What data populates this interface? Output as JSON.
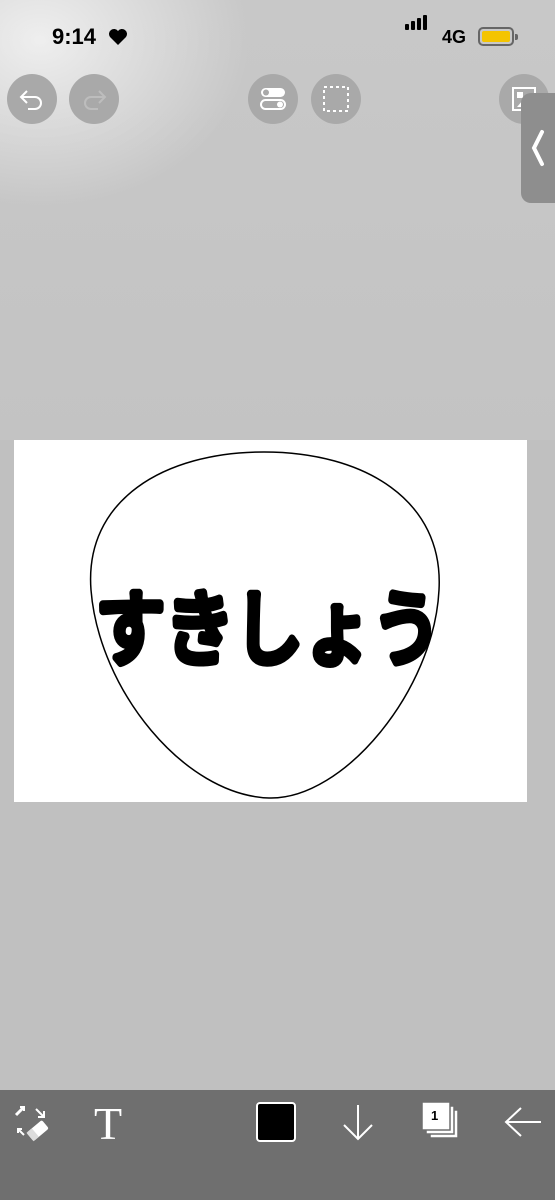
{
  "status_bar": {
    "time": "9:14",
    "network": "4G",
    "battery_color": "#f4c400"
  },
  "toolbar": {
    "undo_icon": "undo-icon",
    "redo_icon": "redo-icon",
    "toggle_icon": "toggle-switches-icon",
    "selection_icon": "dashed-selection-icon",
    "gallery_icon": "image-gallery-icon",
    "side_panel_icon": "chevron-left-icon"
  },
  "canvas": {
    "text": "すきしょう",
    "text_color": "#000000",
    "background": "#ffffff"
  },
  "bottom_bar": {
    "transform_icon": "transform-eraser-icon",
    "text_tool": "T",
    "current_color": "#000000",
    "download_icon": "arrow-down-icon",
    "layer_count": "1",
    "back_icon": "arrow-left-icon"
  }
}
